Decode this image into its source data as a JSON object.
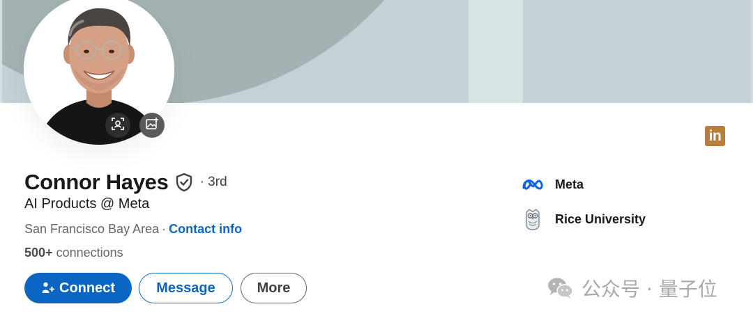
{
  "profile": {
    "name": "Connor Hayes",
    "degree": "· 3rd",
    "headline": "AI Products @ Meta",
    "location": "San Francisco Bay Area",
    "separator": "·",
    "contact_label": "Contact info",
    "connections_count": "500+",
    "connections_label": "connections"
  },
  "actions": {
    "connect_label": "Connect",
    "message_label": "Message",
    "more_label": "More"
  },
  "organizations": [
    {
      "name": "Meta",
      "icon": "meta-logo-icon"
    },
    {
      "name": "Rice University",
      "icon": "rice-owl-logo-icon"
    }
  ],
  "brand_badge": {
    "text": "in",
    "icon": "linkedin-logo-icon",
    "color": "#b87e3a"
  },
  "watermark": {
    "text": "公众号 · 量子位",
    "icon": "wechat-icon"
  },
  "colors": {
    "accent": "#0a66c2",
    "banner_main": "#c3d2d6",
    "banner_arc": "#a3b3b4",
    "text_muted": "#666666"
  }
}
